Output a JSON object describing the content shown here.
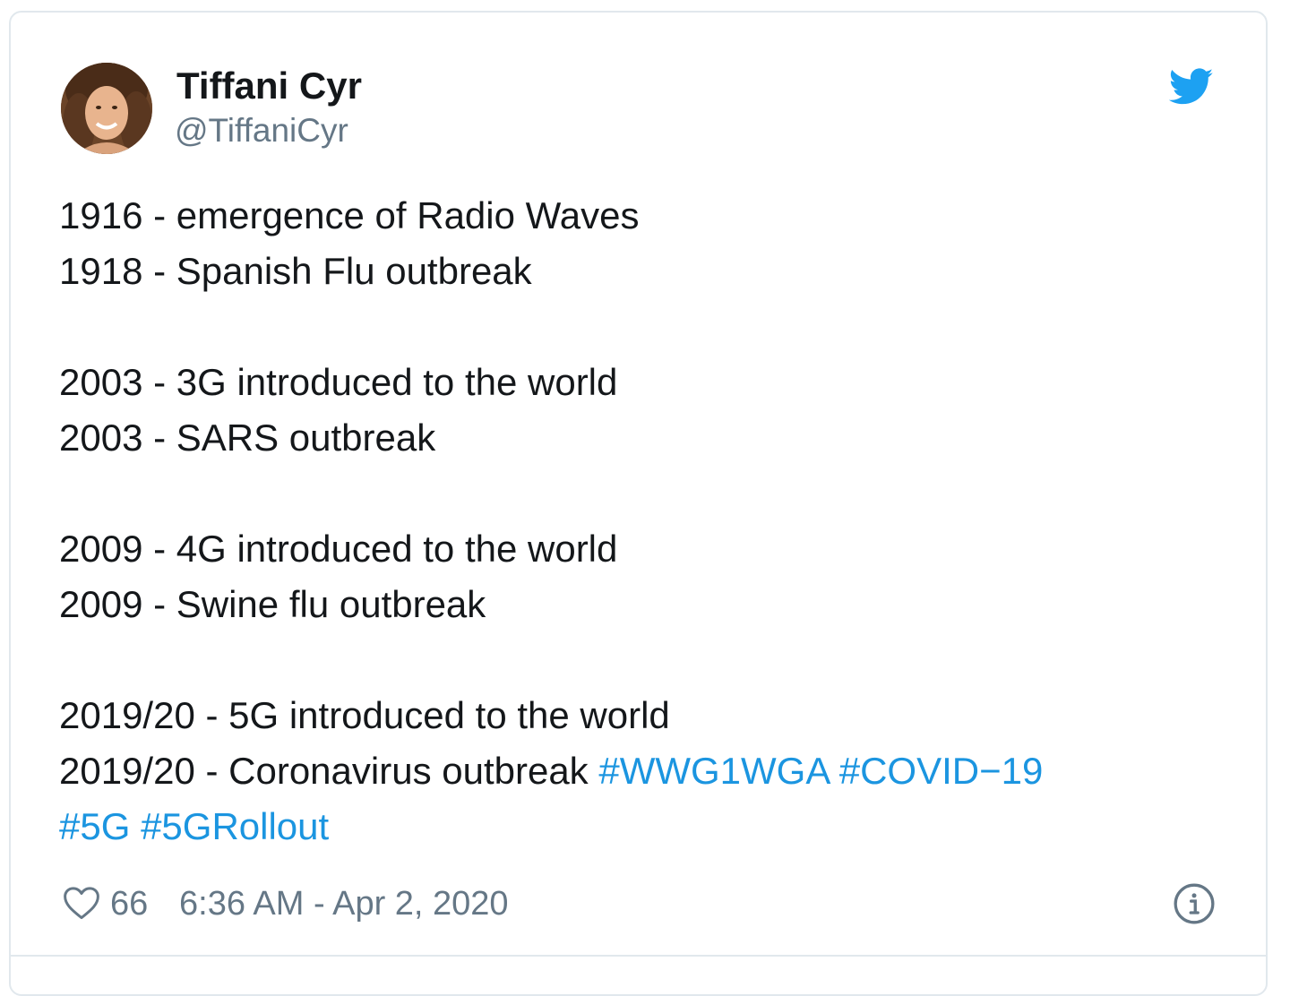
{
  "tweet": {
    "author": {
      "name": "Tiffani Cyr",
      "handle": "@TiffaniCyr",
      "avatar": "avatar-photo"
    },
    "brand_icon": "twitter-bird-icon",
    "brand_color": "#1da1f2",
    "text_lines": [
      {
        "text": "1916 - emergence of Radio Waves"
      },
      {
        "text": "1918 - Spanish Flu outbreak"
      },
      {
        "text": "2003 - 3G introduced to the world"
      },
      {
        "text": "2003 - SARS outbreak"
      },
      {
        "text": "2009 - 4G introduced to the world"
      },
      {
        "text": "2009 - Swine flu outbreak"
      },
      {
        "text": "2019/20 - 5G introduced to the world"
      },
      {
        "text": "2019/20 - Coronavirus outbreak "
      }
    ],
    "hashtags": [
      "#WWG1WGA",
      "#COVID−19",
      "#5G",
      "#5GRollout"
    ],
    "hashtag_color": "#1b95e0",
    "footer": {
      "like_icon": "heart-icon",
      "like_count": "66",
      "timestamp": "6:36 AM - Apr 2, 2020",
      "info_icon": "info-icon"
    }
  }
}
